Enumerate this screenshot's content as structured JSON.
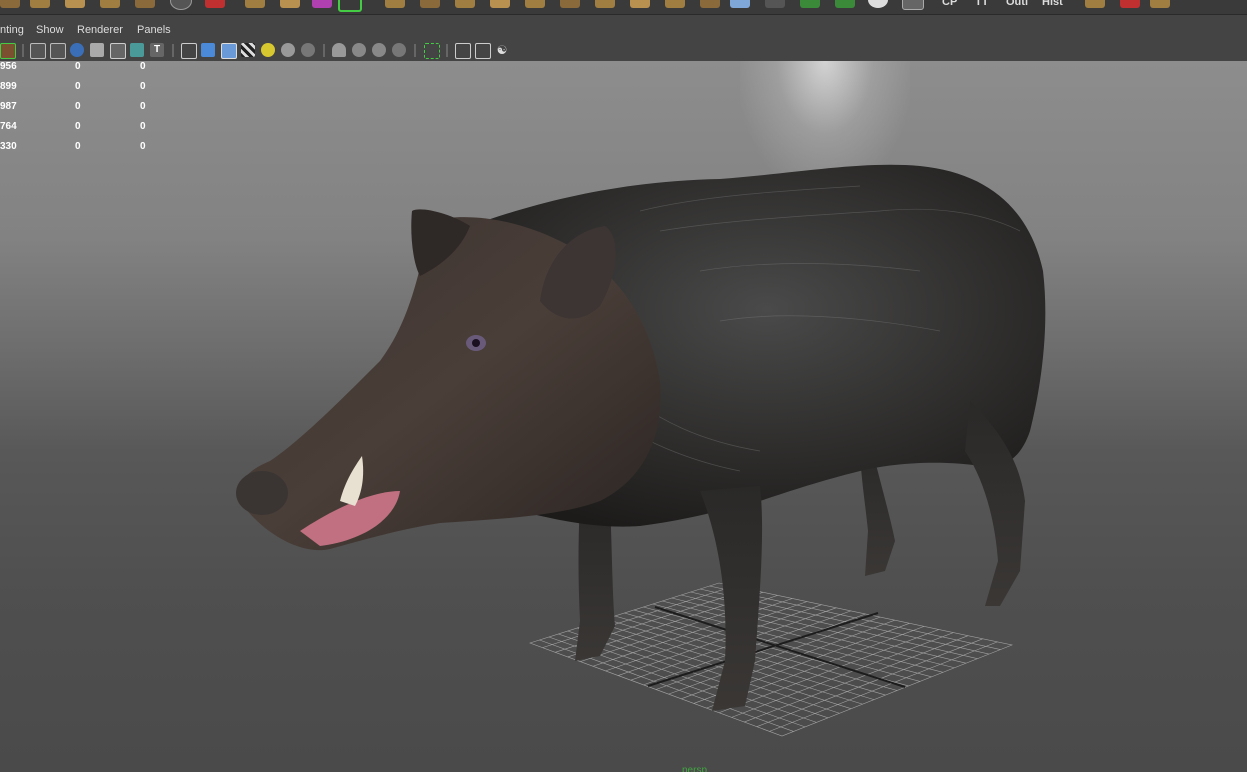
{
  "shelf": {
    "texts": [
      "CP",
      "TT",
      "Outl",
      "Hist"
    ]
  },
  "menu": {
    "items": [
      "nting",
      "Show",
      "Renderer",
      "Panels"
    ]
  },
  "hud": {
    "rows": [
      {
        "label": "956",
        "v1": "0",
        "v2": "0"
      },
      {
        "label": "899",
        "v1": "0",
        "v2": "0"
      },
      {
        "label": "987",
        "v1": "0",
        "v2": "0"
      },
      {
        "label": "764",
        "v1": "0",
        "v2": "0"
      },
      {
        "label": "330",
        "v1": "0",
        "v2": "0"
      }
    ]
  },
  "viewport": {
    "camera_label": "persp"
  },
  "colors": {
    "accent": "#3fa63f",
    "panel_bg": "#444444"
  }
}
